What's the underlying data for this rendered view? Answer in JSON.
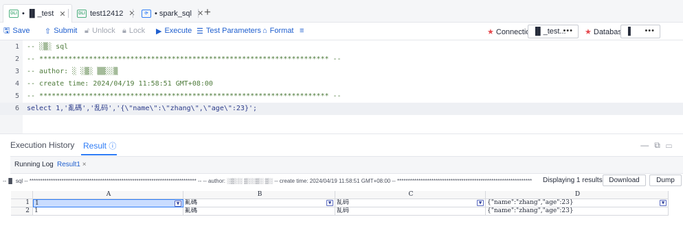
{
  "tabs": [
    {
      "icon": "DLI",
      "label": "• ▐▌_test",
      "active": true
    },
    {
      "icon": "DLI",
      "label": "test12412",
      "active": false
    },
    {
      "icon": "DLI",
      "label": "• spark_sql",
      "active": false
    }
  ],
  "toolbar": {
    "save": "Save",
    "submit": "Submit",
    "unlock": "Unlock",
    "lock": "Lock",
    "execute": "Execute",
    "test_parameters": "Test Parameters",
    "format": "Format",
    "connection_label": "Connection",
    "connection_value": "▐▌_test...",
    "database_label": "Database",
    "database_value": "▐"
  },
  "editor": {
    "lines": [
      {
        "num": "1",
        "text": "-- ░▒░ sql"
      },
      {
        "num": "2",
        "text": "-- ********************************************************************** --"
      },
      {
        "num": "3",
        "text": "-- author: ░ ░▒░ ▒▒░░▒"
      },
      {
        "num": "4",
        "text": "-- create time: 2024/04/19 11:58:51 GMT+08:00"
      },
      {
        "num": "5",
        "text": "-- ********************************************************************** --"
      },
      {
        "num": "6",
        "text": "select 1,'亂碼','乱码','{\\\"name\\\":\\\"zhang\\\",\\\"age\\\":23}';"
      }
    ]
  },
  "panel": {
    "tab_history": "Execution History",
    "tab_result": "Result",
    "subtab_running": "Running Log",
    "subtab_result": "Result1",
    "sql_summary": "--▐▌ sql -- ****************************************************************************** -- -- author: ░▒░░ ▒░░▒░ ▒░ -- create time: 2024/04/19 11:58:51 GMT+08:00 -- ******************************************************************************...",
    "displaying": "Displaying 1 results",
    "download": "Download",
    "dump": "Dump"
  },
  "grid": {
    "columns": [
      "A",
      "B",
      "C",
      "D"
    ],
    "rows": [
      {
        "num": "1",
        "cells": [
          "1",
          "亂碼",
          "乱码",
          "{\"name\":\"zhang\",\"age\":23}"
        ]
      },
      {
        "num": "2",
        "cells": [
          "1",
          "亂碼",
          "乱码",
          "{\"name\":\"zhang\",\"age\":23}"
        ]
      }
    ]
  },
  "colors": {
    "accent": "#2e7cf6",
    "required": "#e5484d",
    "comment": "#4d7a3a",
    "string": "#c0348a",
    "keyword": "#2a3a8a"
  }
}
